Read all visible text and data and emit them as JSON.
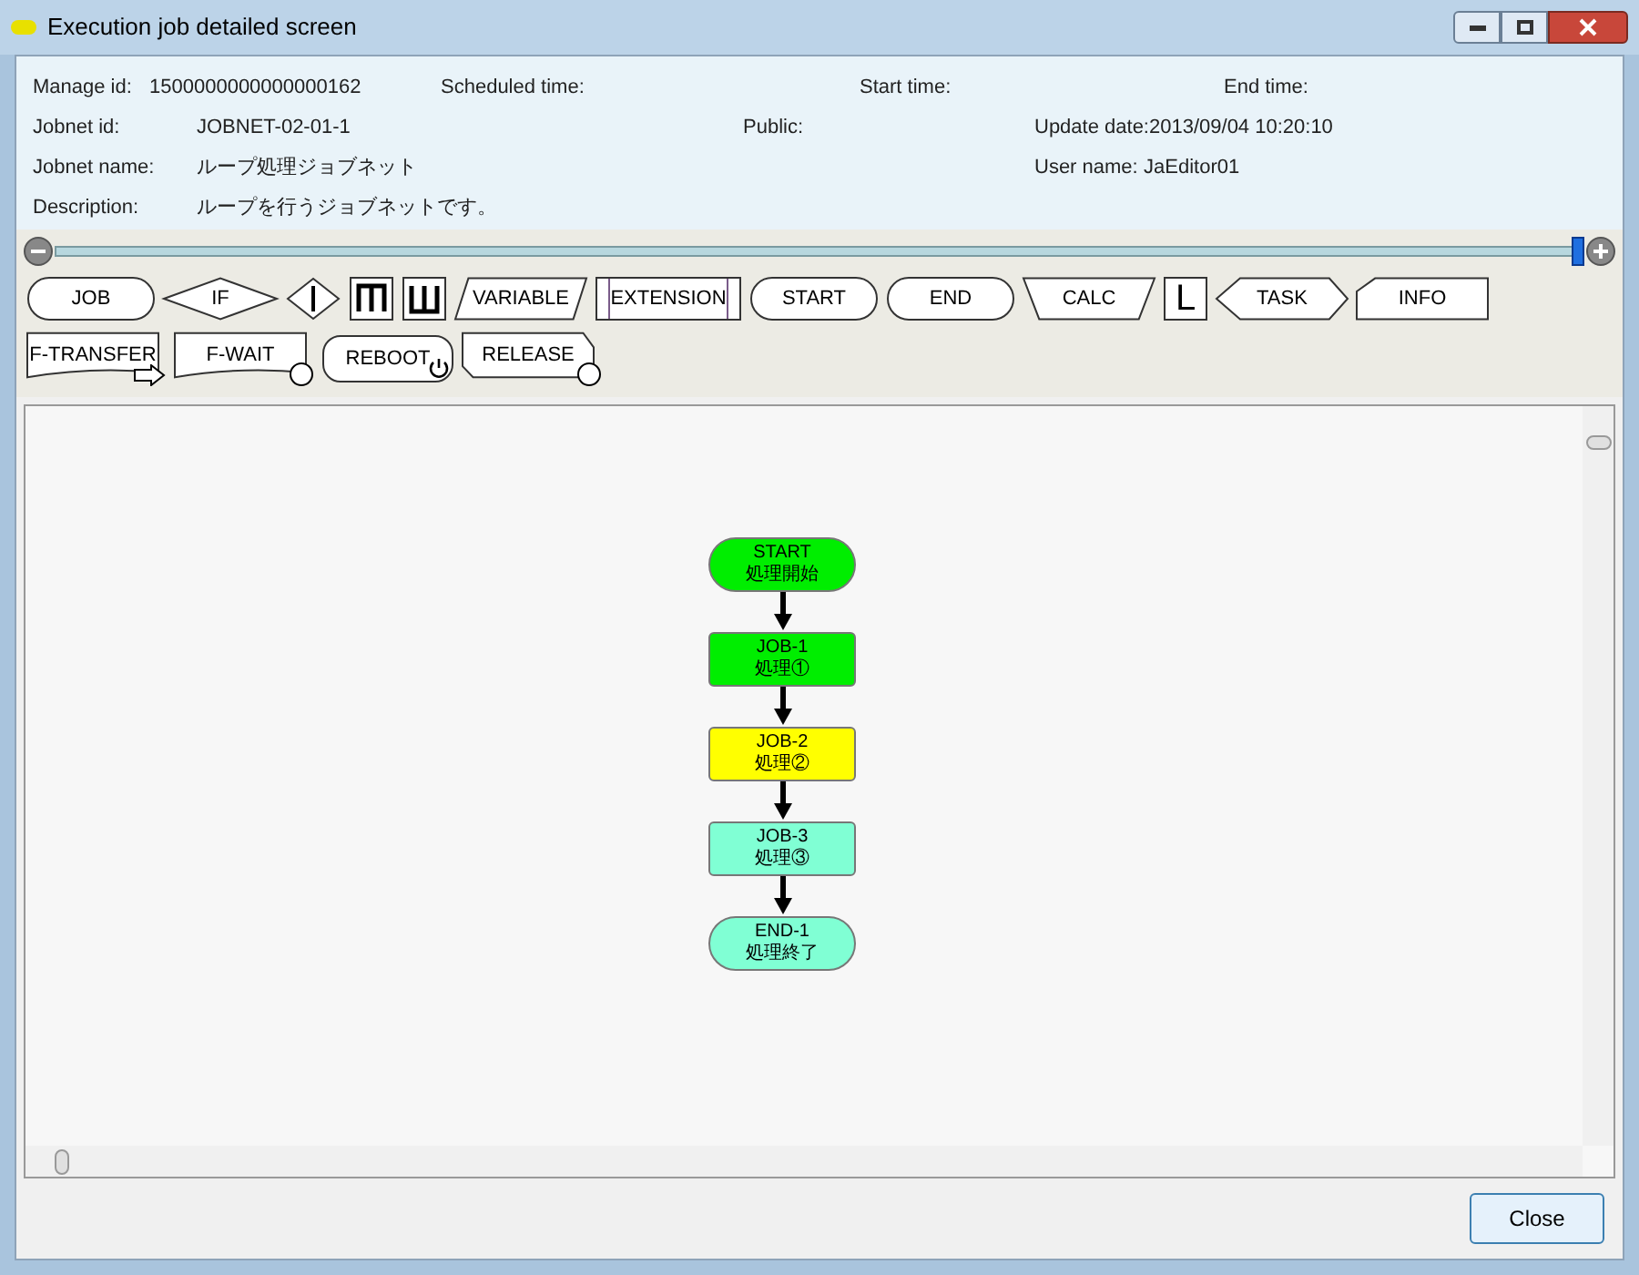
{
  "window": {
    "title": "Execution job detailed screen"
  },
  "info": {
    "manage_id_label": "Manage id:",
    "manage_id": "1500000000000000162",
    "scheduled_label": "Scheduled time:",
    "start_label": "Start time:",
    "end_label": "End time:",
    "jobnet_id_label": "Jobnet id:",
    "jobnet_id": "JOBNET-02-01-1",
    "public_label": "Public:",
    "update_label": "Update date:",
    "update_date": "2013/09/04 10:20:10",
    "jobnet_name_label": "Jobnet name:",
    "jobnet_name": "ループ処理ジョブネット",
    "user_label": "User name:",
    "user_name": "JaEditor01",
    "description_label": "Description:",
    "description": "ループを行うジョブネットです。"
  },
  "zoom": {
    "level": 1
  },
  "palette_rows": [
    [
      {
        "kind": "pill",
        "label": "JOB"
      },
      {
        "kind": "diamond",
        "label": "IF"
      },
      {
        "kind": "diamond-bar"
      },
      {
        "kind": "box-m"
      },
      {
        "kind": "box-w"
      },
      {
        "kind": "parallelogram",
        "label": "VARIABLE"
      },
      {
        "kind": "extension",
        "label": "EXTENSION"
      },
      {
        "kind": "pill",
        "label": "START"
      },
      {
        "kind": "pill",
        "label": "END"
      },
      {
        "kind": "trapezoid",
        "label": "CALC"
      },
      {
        "kind": "letter",
        "label": "L"
      },
      {
        "kind": "hexagon",
        "label": "TASK"
      },
      {
        "kind": "pentagon",
        "label": "INFO"
      }
    ],
    [
      {
        "kind": "transfer",
        "label": "F-TRANSFER"
      },
      {
        "kind": "wait",
        "label": "F-WAIT"
      },
      {
        "kind": "reboot",
        "label": "REBOOT"
      },
      {
        "kind": "release",
        "label": "RELEASE"
      }
    ]
  ],
  "flow": [
    {
      "kind": "terminal",
      "title": "START",
      "subtitle": "処理開始",
      "color": "#00ee00"
    },
    {
      "kind": "job",
      "title": "JOB-1",
      "subtitle": "処理①",
      "color": "#00ee00"
    },
    {
      "kind": "job",
      "title": "JOB-2",
      "subtitle": "処理②",
      "color": "#ffff00"
    },
    {
      "kind": "job",
      "title": "JOB-3",
      "subtitle": "処理③",
      "color": "#80ffd4"
    },
    {
      "kind": "terminal",
      "title": "END-1",
      "subtitle": "処理終了",
      "color": "#80ffd4"
    }
  ],
  "buttons": {
    "close": "Close"
  }
}
